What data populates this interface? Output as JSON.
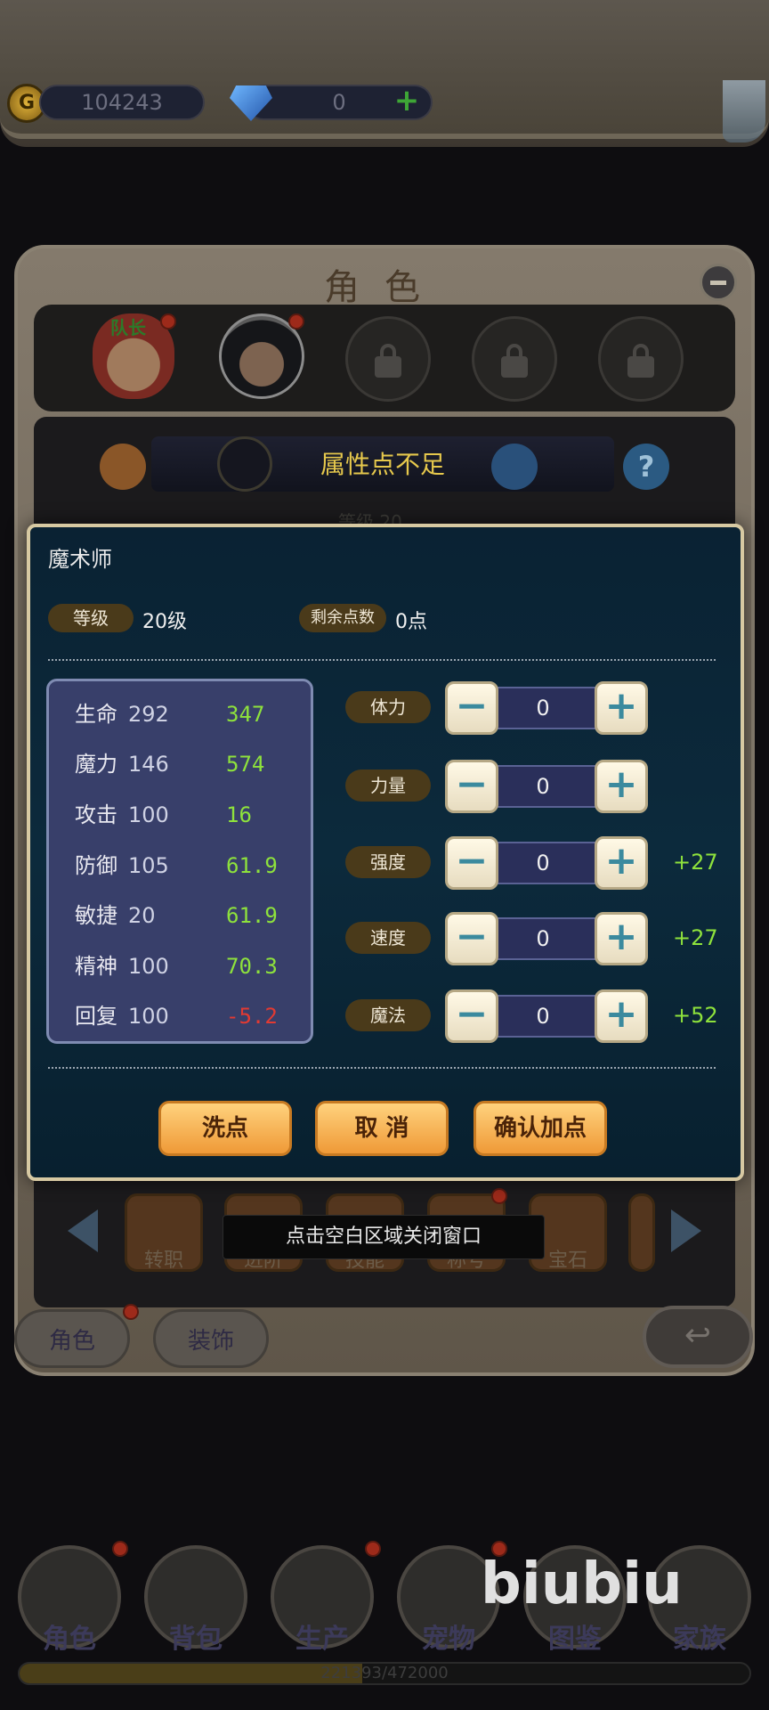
{
  "resources": {
    "gold": "104243",
    "diamonds": "0"
  },
  "panel": {
    "title": "角色",
    "captain_label": "队长",
    "banner_text": "属性点不足",
    "level_ghost": "等级 20"
  },
  "dialog": {
    "class_name": "魔术师",
    "level_tag": "等级",
    "level_value": "20级",
    "remaining_tag": "剩余点数",
    "remaining_value": "0点",
    "stats": [
      {
        "name": "生命",
        "base": "292",
        "bonus": "347"
      },
      {
        "name": "魔力",
        "base": "146",
        "bonus": "574"
      },
      {
        "name": "攻击",
        "base": "100",
        "bonus": "16"
      },
      {
        "name": "防御",
        "base": "105",
        "bonus": "61.9"
      },
      {
        "name": "敏捷",
        "base": "20",
        "bonus": "61.9"
      },
      {
        "name": "精神",
        "base": "100",
        "bonus": "70.3"
      },
      {
        "name": "回复",
        "base": "100",
        "bonus": "-5.2"
      }
    ],
    "attributes": [
      {
        "label": "体力",
        "value": "0",
        "bonus": ""
      },
      {
        "label": "力量",
        "value": "0",
        "bonus": ""
      },
      {
        "label": "强度",
        "value": "0",
        "bonus": "+27"
      },
      {
        "label": "速度",
        "value": "0",
        "bonus": "+27"
      },
      {
        "label": "魔法",
        "value": "0",
        "bonus": "+52"
      }
    ],
    "buttons": {
      "reset": "洗点",
      "cancel": "取 消",
      "confirm": "确认加点"
    }
  },
  "toast": "点击空白区域关闭窗口",
  "functions": [
    "转职",
    "进阶",
    "技能",
    "称号",
    "宝石"
  ],
  "bottom_tabs": {
    "character": "角色",
    "decor": "装饰"
  },
  "main_nav": [
    "角色",
    "背包",
    "生产",
    "宠物",
    "图鉴",
    "家族"
  ],
  "xp": {
    "text": "221393/472000",
    "fraction": 0.469
  },
  "watermark": "biubiu"
}
